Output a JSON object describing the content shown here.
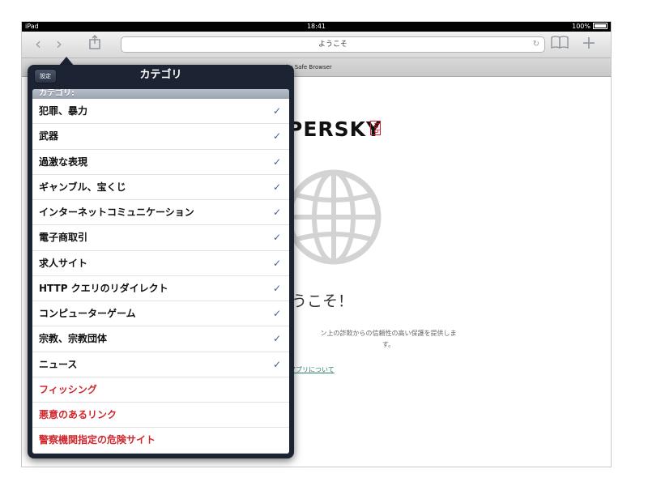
{
  "status_bar": {
    "device": "iPad",
    "time": "18:41",
    "battery": "100%"
  },
  "toolbar": {
    "url_text": "ようこそ"
  },
  "tab": {
    "title": "rsky Safe Browser"
  },
  "page": {
    "logo_text": "PERSKY",
    "logo_lab": "lab",
    "welcome": "うこそ！",
    "description_line1": "ン上の詐欺からの信頼性の高い保護を提供しま",
    "description_line2": "す。",
    "about_link": "アプリについて"
  },
  "popover": {
    "back_button": "設定",
    "title": "カテゴリ",
    "section_header": "カテゴリ:",
    "items": [
      {
        "label": "犯罪、暴力",
        "checked": true
      },
      {
        "label": "武器",
        "checked": true
      },
      {
        "label": "過激な表現",
        "checked": true
      },
      {
        "label": "ギャンブル、宝くじ",
        "checked": true
      },
      {
        "label": "インターネットコミュニケーション",
        "checked": true
      },
      {
        "label": "電子商取引",
        "checked": true
      },
      {
        "label": "求人サイト",
        "checked": true
      },
      {
        "label": "HTTP クエリのリダイレクト",
        "checked": true
      },
      {
        "label": "コンピューターゲーム",
        "checked": true
      },
      {
        "label": "宗教、宗教団体",
        "checked": true
      },
      {
        "label": "ニュース",
        "checked": true
      },
      {
        "label": "フィッシング",
        "checked": false
      },
      {
        "label": "悪意のあるリンク",
        "checked": false
      },
      {
        "label": "警察機関指定の危険サイト",
        "checked": false
      }
    ]
  },
  "colors": {
    "accent_check": "#3b5f9c",
    "locked_red": "#d0262d",
    "popover_bg": "#1c2433"
  }
}
